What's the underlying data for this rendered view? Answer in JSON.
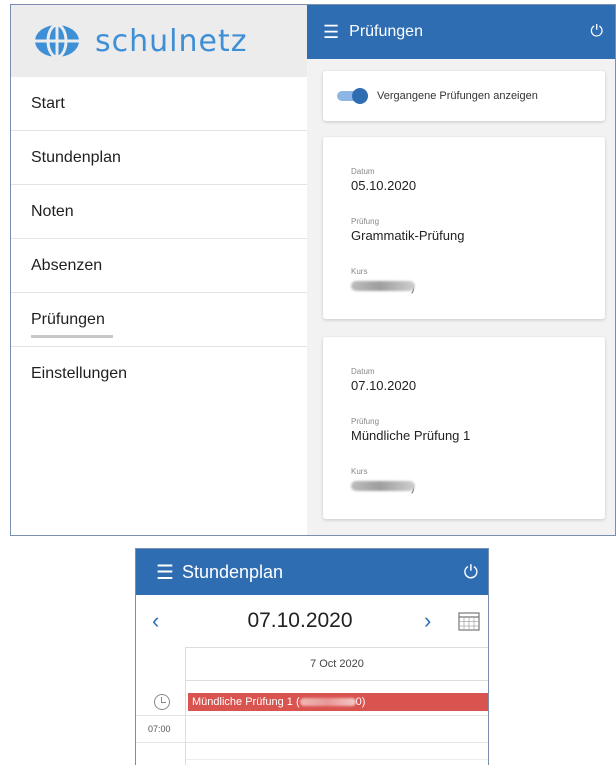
{
  "app": {
    "brand": "schulnetz",
    "brand_color": "#3d8fd6",
    "accent": "#2f6db3"
  },
  "sidebar": {
    "items": [
      {
        "label": "Start",
        "active": false
      },
      {
        "label": "Stundenplan",
        "active": false
      },
      {
        "label": "Noten",
        "active": false
      },
      {
        "label": "Absenzen",
        "active": false
      },
      {
        "label": "Prüfungen",
        "active": true
      },
      {
        "label": "Einstellungen",
        "active": false
      }
    ]
  },
  "header": {
    "title": "Prüfungen",
    "menu_icon": "menu-icon",
    "power_icon": "power-icon"
  },
  "toggle": {
    "label": "Vergangene Prüfungen anzeigen",
    "checked": true
  },
  "exams": [
    {
      "date_label": "Datum",
      "date": "05.10.2020",
      "exam_label": "Prüfung",
      "exam": "Grammatik-Prüfung",
      "course_label": "Kurs",
      "course_tail": ")"
    },
    {
      "date_label": "Datum",
      "date": "07.10.2020",
      "exam_label": "Prüfung",
      "exam": "Mündliche Prüfung 1",
      "course_label": "Kurs",
      "course_tail": ")"
    }
  ],
  "timetable": {
    "title": "Stundenplan",
    "date": "07.10.2020",
    "prev_icon": "chevron-left-icon",
    "next_icon": "chevron-right-icon",
    "calendar_icon": "calendar-icon",
    "day_header": "7 Oct 2020",
    "event": {
      "title": "Mündliche Prüfung 1 (",
      "tail": "0)",
      "color": "#d9534f"
    },
    "time_label": "07:00"
  }
}
